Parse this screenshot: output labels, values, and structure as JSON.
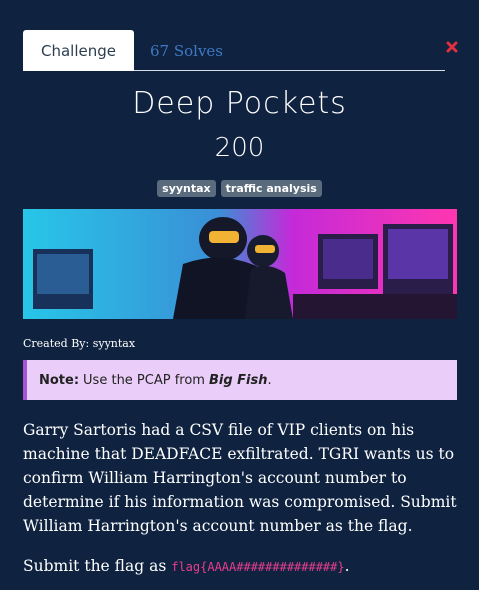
{
  "tabs": {
    "challenge": "Challenge",
    "solves": "67 Solves"
  },
  "challenge": {
    "title": "Deep Pockets",
    "points": "200",
    "tags": [
      "syyntax",
      "traffic analysis"
    ],
    "created_by": "Created By: syyntax"
  },
  "note": {
    "label": "Note:",
    "text": "Use the PCAP from",
    "ref": "Big Fish",
    "end": "."
  },
  "description": "Garry Sartoris had a CSV file of VIP clients on his machine that DEADFACE exfiltrated. TGRI wants us to confirm William Harrington's account number to determine if his information was compromised. Submit William Harrington's account number as the flag.",
  "flag": {
    "prefix": "Submit the flag as",
    "format": "flag{AAAA##############}",
    "suffix": "."
  },
  "colors": {
    "background": "#0f2340",
    "link": "#3f78c4",
    "note_bg": "#eacdf8",
    "code": "#e83e8c"
  },
  "icons": {
    "close": "close-icon"
  }
}
